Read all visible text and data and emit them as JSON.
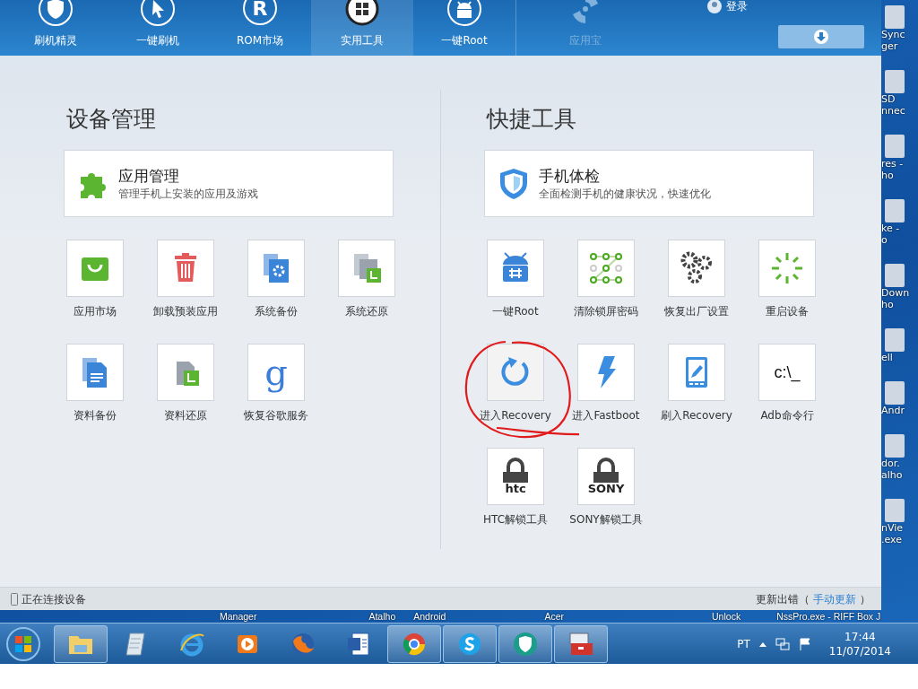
{
  "nav": {
    "tabs": [
      {
        "label": "刷机精灵",
        "selected": false,
        "disabled": false
      },
      {
        "label": "一键刷机",
        "selected": false,
        "disabled": false
      },
      {
        "label": "ROM市场",
        "selected": false,
        "disabled": false,
        "glyph": "R"
      },
      {
        "label": "实用工具",
        "selected": true,
        "disabled": false
      },
      {
        "label": "一键Root",
        "selected": false,
        "disabled": false
      },
      {
        "label": "应用宝",
        "selected": false,
        "disabled": true
      }
    ],
    "login": "登录"
  },
  "sections": [
    {
      "title": "设备管理",
      "card": {
        "title": "应用管理",
        "description": "管理手机上安装的应用及游戏"
      },
      "tiles": [
        {
          "label": "应用市场",
          "hover": false,
          "circled": false
        },
        {
          "label": "卸载预装应用",
          "hover": false,
          "circled": false
        },
        {
          "label": "系统备份",
          "hover": false,
          "circled": false
        },
        {
          "label": "系统还原",
          "hover": false,
          "circled": false
        },
        {
          "label": "资料备份",
          "hover": false,
          "circled": false
        },
        {
          "label": "资料还原",
          "hover": false,
          "circled": false
        },
        {
          "label": "恢复谷歌服务",
          "hover": false,
          "circled": false,
          "glyph": "g"
        }
      ]
    },
    {
      "title": "快捷工具",
      "card": {
        "title": "手机体检",
        "description": "全面检测手机的健康状况，快速优化"
      },
      "tiles": [
        {
          "label": "一键Root",
          "hover": false,
          "circled": false
        },
        {
          "label": "清除锁屏密码",
          "hover": false,
          "circled": false
        },
        {
          "label": "恢复出厂设置",
          "hover": false,
          "circled": false
        },
        {
          "label": "重启设备",
          "hover": false,
          "circled": false
        },
        {
          "label": "进入Recovery",
          "hover": true,
          "circled": true
        },
        {
          "label": "进入Fastboot",
          "hover": false,
          "circled": false
        },
        {
          "label": "刷入Recovery",
          "hover": false,
          "circled": false
        },
        {
          "label": "Adb命令行",
          "hover": false,
          "circled": false,
          "glyph": "c:\\_"
        },
        {
          "label": "HTC解锁工具",
          "hover": false,
          "circled": false,
          "glyph": "htc"
        },
        {
          "label": "SONY解锁工具",
          "hover": false,
          "circled": false,
          "glyph": "SONY"
        }
      ]
    }
  ],
  "status_bar": {
    "connection": "正在连接设备",
    "error": "更新出错（ ",
    "link": "手动更新",
    "after": " ）"
  },
  "desktop": {
    "edge_labels": [
      [
        "Sync",
        "ger"
      ],
      [
        "SD",
        "nnec"
      ],
      [
        "res -",
        "ho"
      ],
      [
        "ke -",
        "o"
      ],
      [
        "Down",
        "ho"
      ],
      [
        "ell"
      ],
      [
        "Andr"
      ],
      [
        "dor.",
        "alho"
      ],
      [
        "nVie",
        ".exe"
      ]
    ],
    "bottom_labels": [
      "Manager",
      "Atalho",
      "Android",
      "Acer",
      "Unlock",
      "NssPro.exe - RIFF Box J"
    ]
  },
  "taskbar": {
    "apps": [
      {
        "running": true
      },
      {
        "running": false
      },
      {
        "running": false
      },
      {
        "running": false
      },
      {
        "running": false
      },
      {
        "running": false
      },
      {
        "running": true
      },
      {
        "running": true
      },
      {
        "running": true
      },
      {
        "running": true
      }
    ],
    "language": "PT",
    "time": "17:44",
    "date": "11/07/2014"
  }
}
